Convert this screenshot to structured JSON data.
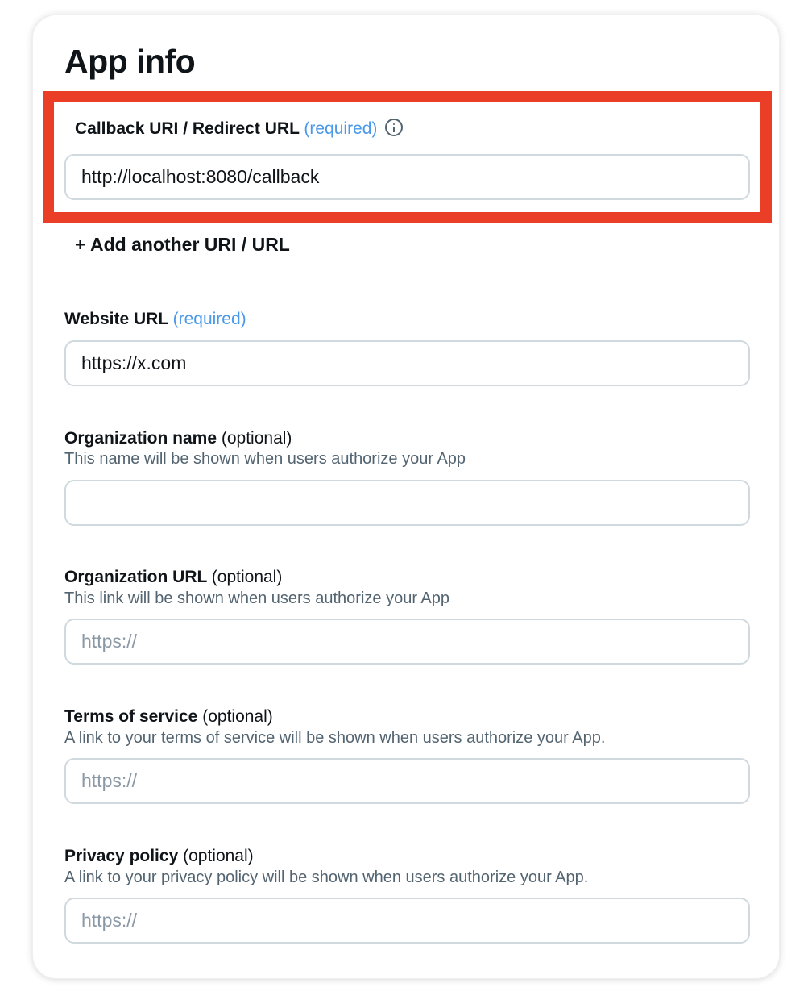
{
  "title": "App info",
  "callback": {
    "label": "Callback URI / Redirect URL",
    "required": "(required)",
    "value": "http://localhost:8080/callback",
    "add_link": "+ Add another URI / URL"
  },
  "website": {
    "label": "Website URL",
    "required": "(required)",
    "value": "https://x.com"
  },
  "organization_name": {
    "label": "Organization name",
    "optional": "(optional)",
    "description": "This name will be shown when users authorize your App",
    "value": ""
  },
  "organization_url": {
    "label": "Organization URL",
    "optional": "(optional)",
    "description": "This link will be shown when users authorize your App",
    "placeholder": "https://"
  },
  "terms": {
    "label": "Terms of service",
    "optional": "(optional)",
    "description": "A link to your terms of service will be shown when users authorize your App.",
    "placeholder": "https://"
  },
  "privacy": {
    "label": "Privacy policy",
    "optional": "(optional)",
    "description": "A link to your privacy policy will be shown when users authorize your App.",
    "placeholder": "https://"
  },
  "colors": {
    "highlight": "#ea3f26",
    "required_text": "#4a99e9",
    "secondary_text": "#536471",
    "field_border": "#cfd9de"
  },
  "icons": {
    "callback_info": "info-icon"
  }
}
